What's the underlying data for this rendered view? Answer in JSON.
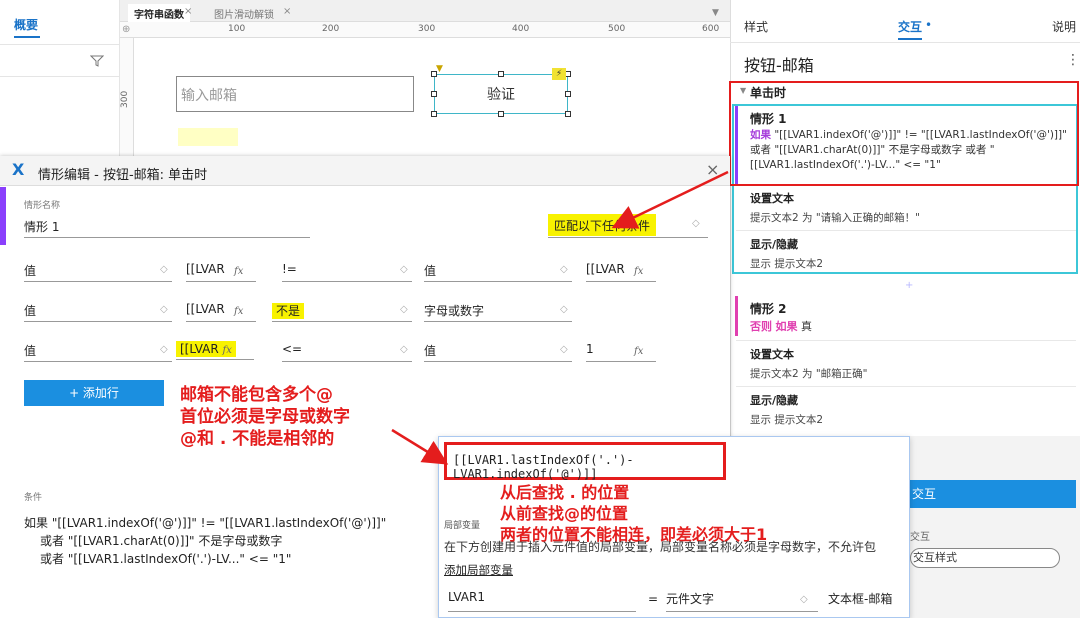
{
  "left_panel": {
    "tab_label": "概要"
  },
  "canvas": {
    "tabs": [
      {
        "label": "字符串函数",
        "close": "×"
      },
      {
        "label": "图片滑动解锁",
        "close": "×"
      }
    ],
    "ruler_h_ticks": [
      "100",
      "200",
      "300",
      "400",
      "500",
      "600"
    ],
    "ruler_v_label": "300",
    "email_placeholder": "输入邮箱",
    "verify_label": "验证"
  },
  "right_panel": {
    "tabs": {
      "style": "样式",
      "interaction": "交互",
      "notes": "说明"
    },
    "widget_name": "按钮-邮箱",
    "menu_glyph": "⋮",
    "event_label": "单击时",
    "case1": {
      "title": "情形 1",
      "cond_if": "如果",
      "cond_text": "\"[[LVAR1.indexOf('@')]]\" != \"[[LVAR1.lastIndexOf('@')]]\" 或者 \"[[LVAR1.charAt(0)]]\" 不是字母或数字  或者 \"[[LVAR1.lastIndexOf('.')-LV...\" <= \"1\"",
      "action1_title": "设置文本",
      "action1_detail": "提示文本2 为 \"请输入正确的邮箱！\"",
      "action2_title": "显示/隐藏",
      "action2_detail": "显示 提示文本2"
    },
    "case2": {
      "title": "情形 2",
      "cond_else": "否则",
      "cond_if": "如果",
      "cond_value": "真",
      "action1_title": "设置文本",
      "action1_detail": "提示文本2 为 \"邮箱正确\"",
      "action2_title": "显示/隐藏",
      "action2_detail": "显示 提示文本2"
    },
    "new_interaction_label": "交互",
    "more_label": "交互",
    "style_button_label": "交互样式"
  },
  "dialog": {
    "logo": "X",
    "title": "情形编辑  -  按钮-邮箱: 单击时",
    "close": "×",
    "case_name_label": "情形名称",
    "case_name_value": "情形 1",
    "match_option": "匹配以下任何条件",
    "rows": [
      {
        "left_type": "值",
        "left_value": "[[LVAR",
        "operator": "!=",
        "right_type": "值",
        "right_value": "[[LVAR"
      },
      {
        "left_type": "值",
        "left_value": "[[LVAR",
        "operator": "不是",
        "right_type": "字母或数字",
        "right_value": ""
      },
      {
        "left_type": "值",
        "left_value": "[[LVAR",
        "operator": "<=",
        "right_type": "值",
        "right_value": "1"
      }
    ],
    "fx_glyph": "fx",
    "add_row_label": "+ 添加行",
    "condition_section_label": "条件",
    "condition_summary": [
      "如果 \"[[LVAR1.indexOf('@')]]\" != \"[[LVAR1.lastIndexOf('@')]]\"",
      "或者 \"[[LVAR1.charAt(0)]]\" 不是字母或数字",
      "或者 \"[[LVAR1.lastIndexOf('.')-LV...\" <= \"1\""
    ]
  },
  "annotations": {
    "note1": [
      "邮箱不能包含多个@",
      "首位必须是字母或数字",
      "@和 . 不能是相邻的"
    ],
    "note2": [
      "从后查找 . 的位置",
      "从前查找@的位置",
      "两者的位置不能相连，即差必须大于1"
    ]
  },
  "popup": {
    "expression": "[[LVAR1.lastIndexOf('.')-LVAR1.indexOf('@')]]",
    "local_var_label": "局部变量",
    "local_var_desc": "在下方创建用于插入元件值的局部变量，局部变量名称必须是字母数字，不允许包",
    "add_local_var": "添加局部变量",
    "var_name": "LVAR1",
    "var_eq": "=",
    "var_type": "元件文字",
    "var_target": "文本框-邮箱"
  },
  "colors": {
    "accent_blue": "#1b8fe0",
    "highlight_yellow": "#f8f200",
    "annotation_red": "#e41d1d",
    "case1_purple": "#8a3ffc",
    "case2_pink": "#e040b0",
    "selection_cyan": "#3cc7d8"
  }
}
